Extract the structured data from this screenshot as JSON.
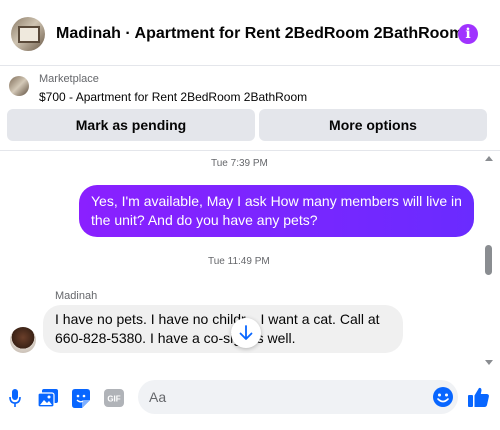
{
  "header": {
    "title": "Madinah · Apartment for Rent 2BedRoom 2BathRoom",
    "info_icon": "info-icon",
    "accent_color": "#a033ff"
  },
  "marketplace": {
    "label": "Marketplace",
    "item": "$700 - Apartment for Rent 2BedRoom 2BathRoom",
    "mark_pending_label": "Mark as pending",
    "more_options_label": "More options"
  },
  "conversation": {
    "timestamp_1": "Tue 7:39 PM",
    "outgoing_message": "Yes, I'm available, May I ask How many members will live in the unit? And do you have any pets?",
    "timestamp_2": "Tue 11:49 PM",
    "sender_name": "Madinah",
    "incoming_message": "I have no pets. I have no childr... I want a cat. Call at 660-828-5380. I have a co-sig... s well."
  },
  "composer": {
    "placeholder": "Aa",
    "icons": [
      "microphone-icon",
      "photo-icon",
      "sticker-icon",
      "gif-icon",
      "emoji-icon",
      "thumbs-up-icon"
    ],
    "gif_label": "GIF"
  },
  "colors": {
    "outgoing_bubble": "#7b25ff",
    "icon_blue": "#0866ff",
    "incoming_bubble": "#f0f0f0"
  }
}
